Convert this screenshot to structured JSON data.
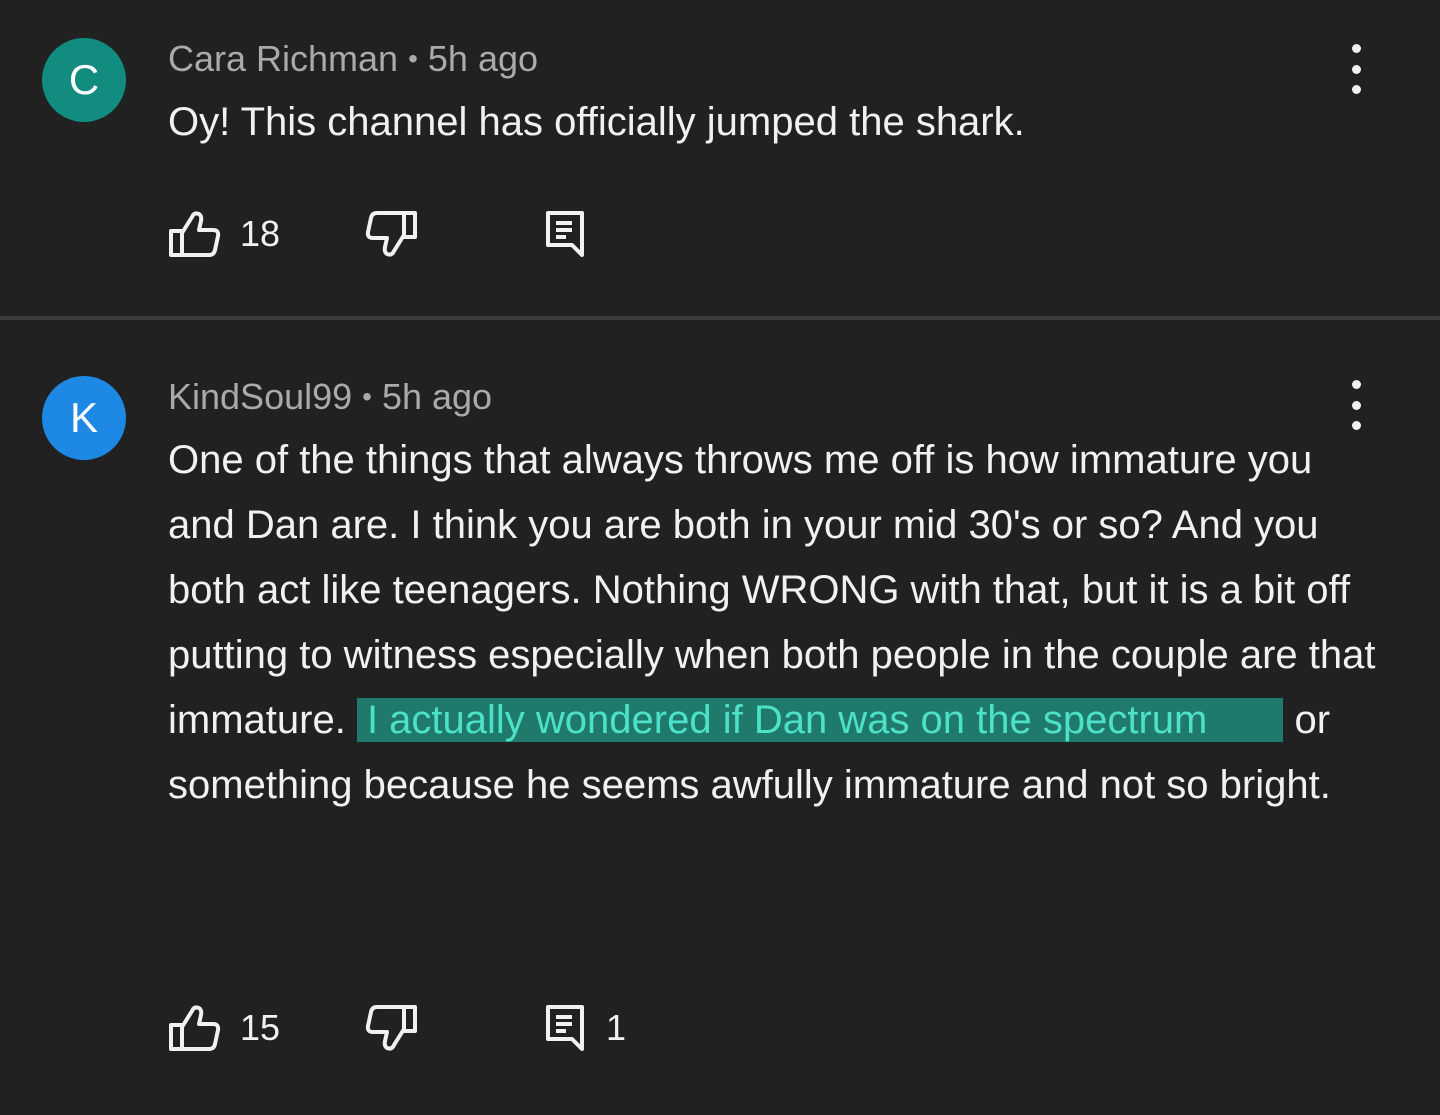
{
  "colors": {
    "background": "#212121",
    "divider": "#3a3a3a",
    "avatar_c": "#128c7e",
    "avatar_k": "#1e88e5",
    "highlight_bg": "#1f7a6c",
    "highlight_text": "#4de1c8"
  },
  "comments": [
    {
      "avatar_letter": "C",
      "author": "Cara Richman",
      "separator": "•",
      "time": "5h ago",
      "text_plain": "Oy! This channel has officially jumped the shark.",
      "likes": "18",
      "replies": "",
      "icons": [
        "like-icon",
        "dislike-icon",
        "reply-icon",
        "more-vertical-icon"
      ]
    },
    {
      "avatar_letter": "K",
      "author": "KindSoul99",
      "separator": "•",
      "time": "5h ago",
      "text_before": "One of the things that always throws me off is how immature you and Dan are. I think you are both in your mid 30's or so? And you both act like teenagers. Nothing WRONG with that, but it is a bit off putting to witness especially when both people in the couple are that immature. ",
      "text_highlight": "I actually wondered if Dan was on the spectrum",
      "text_after": " or something because he seems awfully immature and not so bright.",
      "likes": "15",
      "replies": "1",
      "icons": [
        "like-icon",
        "dislike-icon",
        "reply-icon",
        "more-vertical-icon"
      ]
    }
  ]
}
